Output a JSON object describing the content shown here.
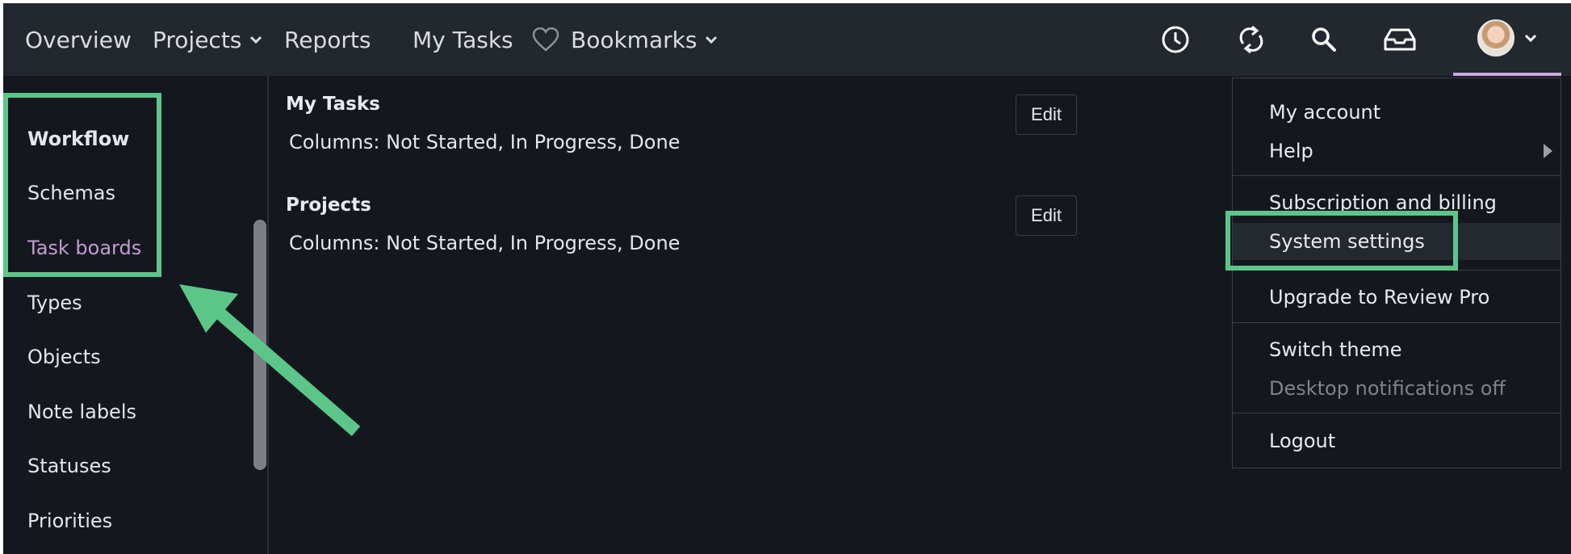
{
  "nav": {
    "items": [
      {
        "label": "Overview"
      },
      {
        "label": "Projects"
      },
      {
        "label": "Reports"
      },
      {
        "label": "My Tasks"
      },
      {
        "label": "Bookmarks"
      }
    ],
    "icons": [
      "clock-icon",
      "sync-icon",
      "search-icon",
      "inbox-icon"
    ]
  },
  "sidebar": {
    "items": [
      {
        "label": "Workflow"
      },
      {
        "label": "Schemas"
      },
      {
        "label": "Task boards"
      },
      {
        "label": "Types"
      },
      {
        "label": "Objects"
      },
      {
        "label": "Note labels"
      },
      {
        "label": "Statuses"
      },
      {
        "label": "Priorities"
      }
    ]
  },
  "boards": [
    {
      "title": "My Tasks",
      "desc": "Columns: Not Started, In Progress, Done",
      "edit": "Edit"
    },
    {
      "title": "Projects",
      "desc": "Columns: Not Started, In Progress, Done",
      "edit": "Edit"
    }
  ],
  "user_menu": {
    "items": [
      {
        "label": "My account"
      },
      {
        "label": "Help"
      },
      {
        "label": "Subscription and billing"
      },
      {
        "label": "System settings"
      },
      {
        "label": "Upgrade to Review Pro"
      },
      {
        "label": "Switch theme"
      },
      {
        "label": "Desktop notifications off"
      },
      {
        "label": "Logout"
      }
    ]
  },
  "colors": {
    "background": "#14181e",
    "topbar": "#23272e",
    "accent": "#c39bd3",
    "annotation": "#5cc689"
  }
}
